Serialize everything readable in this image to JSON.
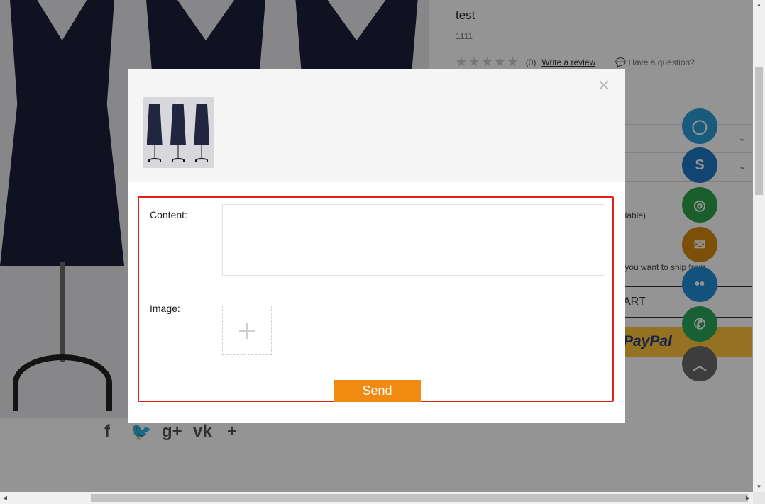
{
  "product": {
    "title": "test",
    "sku": "1111",
    "stars": "★★★★★",
    "review_count": "(0)",
    "write_review": "Write a review",
    "question": "Have a question?",
    "availability_fragment": "ilable)",
    "ship_fragment": "y you want to ship from",
    "cart_fragment": "ART",
    "paypal_label": "PayPal"
  },
  "share_icons": [
    "facebook-icon",
    "twitter-icon",
    "google-plus-icon",
    "vk-icon",
    "plus-icon"
  ],
  "share_glyphs": [
    "f",
    "🐦",
    "g+",
    "vk",
    "+"
  ],
  "float_buttons": [
    {
      "name": "qq-icon",
      "color": "#2a9dd6",
      "glyph": "◯"
    },
    {
      "name": "skype-icon",
      "color": "#1e77c4",
      "glyph": "S"
    },
    {
      "name": "wechat-icon",
      "color": "#2ea44a",
      "glyph": "◎"
    },
    {
      "name": "email-icon",
      "color": "#d78a10",
      "glyph": "✉"
    },
    {
      "name": "messenger-icon",
      "color": "#1f8ed6",
      "glyph": "••"
    },
    {
      "name": "whatsapp-icon",
      "color": "#28a85a",
      "glyph": "✆"
    },
    {
      "name": "back-to-top-icon",
      "color": "#6a6a6a",
      "glyph": "︿"
    }
  ],
  "modal": {
    "close_label": "×",
    "content_label": "Content:",
    "content_value": "",
    "image_label": "Image:",
    "upload_label": "+",
    "send_label": "Send"
  },
  "colors": {
    "form_border": "#e0211b",
    "send_button": "#f08a10"
  }
}
